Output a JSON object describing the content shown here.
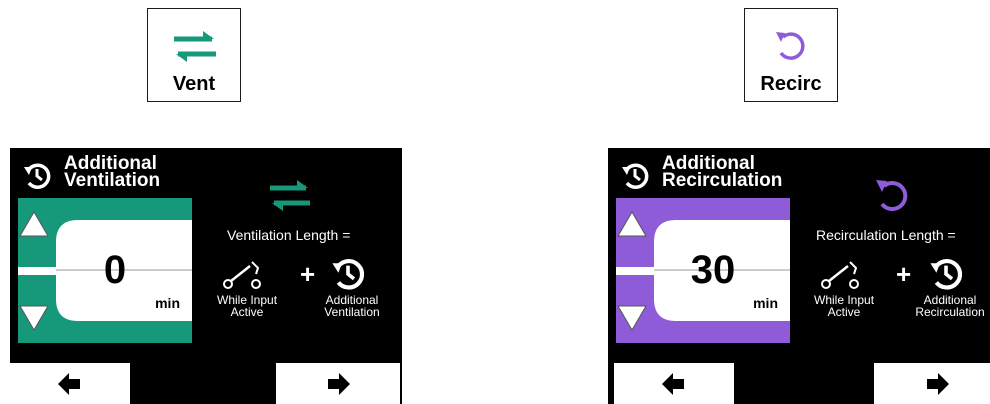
{
  "colors": {
    "vent": "#16997a",
    "recirc": "#8e5cd9",
    "screen_bg": "#000000"
  },
  "buttons": {
    "vent": {
      "label": "Vent",
      "icon": "swap-arrows-icon"
    },
    "recirc": {
      "label": "Recirc",
      "icon": "circular-arrow-icon"
    }
  },
  "vent_screen": {
    "title_line1": "Additional",
    "title_line2": "Ventilation",
    "value": "0",
    "unit": "min",
    "length_label": "Ventilation Length =",
    "plus": "+",
    "while_input_line1": "While Input",
    "while_input_line2": "Active",
    "additional_line1": "Additional",
    "additional_line2": "Ventilation"
  },
  "recirc_screen": {
    "title_line1": "Additional",
    "title_line2": "Recirculation",
    "value": "30",
    "unit": "min",
    "length_label": "Recirculation Length =",
    "plus": "+",
    "while_input_line1": "While Input",
    "while_input_line2": "Active",
    "additional_line1": "Additional",
    "additional_line2": "Recirculation"
  }
}
